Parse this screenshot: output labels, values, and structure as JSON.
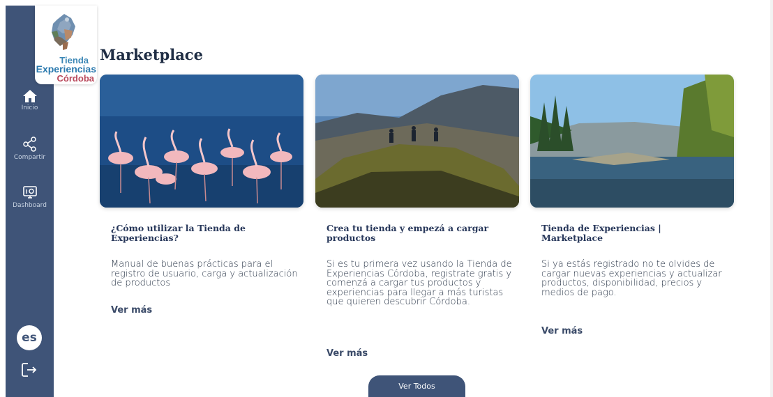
{
  "logo": {
    "line1": "Tienda",
    "line2": "Experiencias",
    "line3": "Córdoba"
  },
  "sidebar": {
    "items": [
      {
        "label": "Inicio",
        "icon": "home-icon"
      },
      {
        "label": "Compartir",
        "icon": "share-icon"
      },
      {
        "label": "Dashboard",
        "icon": "dashboard-icon"
      }
    ],
    "language": "es",
    "logout_icon": "logout-icon"
  },
  "page": {
    "title": "Marketplace"
  },
  "cards": [
    {
      "title": "¿Cómo utilizar la Tienda de Experiencias?",
      "description": "Manual de buenas prácticas para el registro de usuario, carga y actualización de productos",
      "link": "Ver más",
      "image": "flamingos"
    },
    {
      "title": "Crea tu tienda y empezá a cargar productos",
      "description": "Si es tu primera vez usando la Tienda de Experiencias Córdoba, registrate gratis y comenzá a cargar tus productos y experiencias para llegar a más turistas que quieren descubrir Córdoba.",
      "link": "Ver más",
      "image": "mountains"
    },
    {
      "title": "Tienda de Experiencias | Marketplace",
      "description": "Si ya estás registrado no te olvides de cargar nuevas experiencias y actualizar productos, disponibilidad, precios y medios de pago.",
      "link": "Ver más",
      "image": "river"
    }
  ],
  "view_all_label": "Ver Todos",
  "colors": {
    "sidebar": "#3f5478",
    "accent": "#27375a",
    "button": "#3f5478"
  }
}
